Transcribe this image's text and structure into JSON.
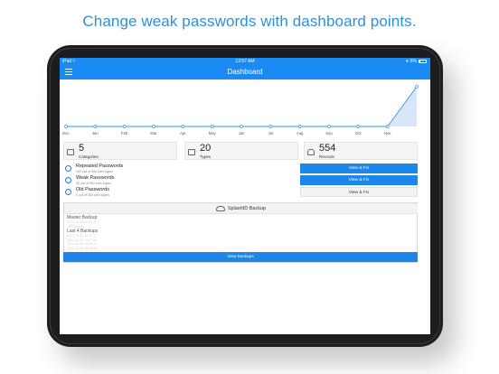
{
  "promo": {
    "title": "Change weak passwords with dashboard points."
  },
  "status_bar": {
    "carrier": "iPad",
    "time": "12:57 AM",
    "battery": "6%"
  },
  "navbar": {
    "title": "Dashboard"
  },
  "chart_data": {
    "type": "area",
    "categories": [
      "Dec",
      "Jan",
      "Feb",
      "Mar",
      "Apr",
      "May",
      "Jun",
      "Jul",
      "Aug",
      "Sep",
      "Oct",
      "Nov",
      ""
    ],
    "values": [
      0,
      0,
      0,
      0,
      0,
      0,
      0,
      0,
      0,
      0,
      0,
      0,
      1
    ],
    "ylim": [
      0,
      1
    ],
    "grid": false,
    "colors": {
      "line": "#3a90e8",
      "fill": "#d7e6f8",
      "marker": "#3a90e8"
    }
  },
  "stats": [
    {
      "value": "5",
      "label": "Categories",
      "icon": "categories-icon"
    },
    {
      "value": "20",
      "label": "Types",
      "icon": "types-icon"
    },
    {
      "value": "554",
      "label": "Records",
      "icon": "records-icon"
    }
  ],
  "passwords": [
    {
      "title": "Repeated Passwords",
      "sub": "163 out of 554 web logins",
      "action": "View & Fix",
      "style": "blue"
    },
    {
      "title": "Weak Passwords",
      "sub": "30 out of 554 web logins",
      "action": "View & Fix",
      "style": "blue"
    },
    {
      "title": "Old Passwords",
      "sub": "0 out of 554 web logins",
      "action": "View & Fix",
      "style": "white"
    }
  ],
  "backup": {
    "title": "SplashID Backup",
    "master_label": "Master Backup",
    "master_lines": [
      "2014-11-05 06:03:45",
      "354 records"
    ],
    "last_label": "Last 4 Backups",
    "last_lines": [
      "2014-11-05 14:57:24",
      "2014-11-05 14:57:28",
      "2014-11-05 14:06:33",
      "2014-11-04 18:18:05"
    ],
    "button": "View backups"
  },
  "colors": {
    "accent": "#1a8bf2",
    "promo": "#2f8fdc"
  }
}
